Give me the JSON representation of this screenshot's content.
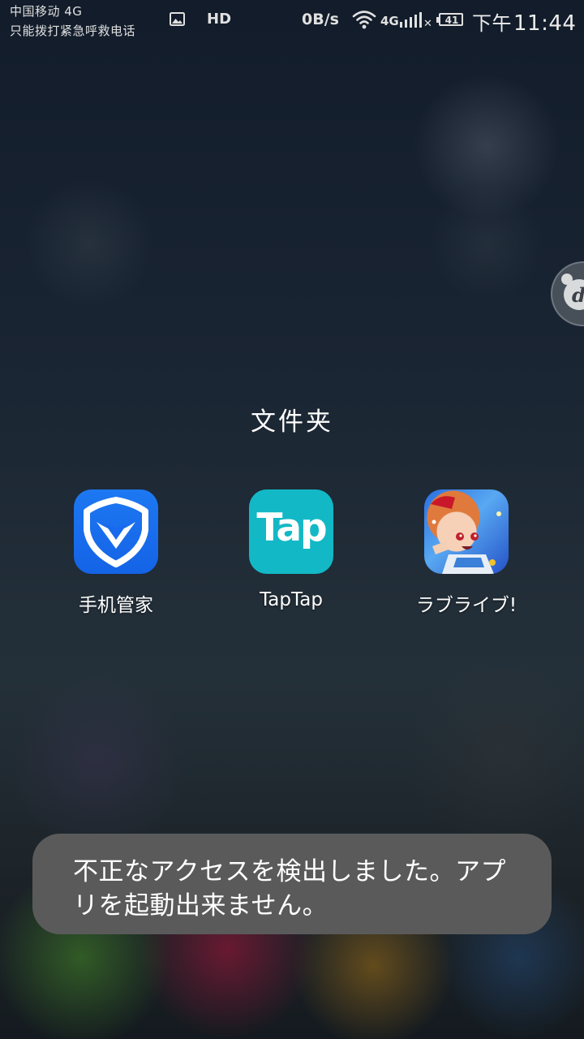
{
  "status_bar": {
    "carrier_line_1": "中国移动 4G",
    "carrier_line_2": "只能拨打紧急呼救电话",
    "hd_label": "HD",
    "net_speed": "0B/s",
    "signal_label": "4G",
    "battery_level": "41",
    "clock_period": "下午",
    "clock_time": "11:44",
    "icons": [
      "gallery-icon",
      "wifi-icon",
      "signal-icon",
      "no-signal-icon",
      "battery-icon"
    ]
  },
  "floating_ball": {
    "letter": "d"
  },
  "folder": {
    "title": "文件夹",
    "apps": [
      {
        "label": "手机管家",
        "icon": "guanjia-shield-icon",
        "color": "#1769ee"
      },
      {
        "label": "TapTap",
        "icon": "taptap-icon",
        "icon_text": "Tap",
        "color": "#13b8c6"
      },
      {
        "label": "ラブライブ!",
        "icon": "lovelive-icon"
      }
    ]
  },
  "toast": {
    "message": "不正なアクセスを検出しました。アプリを起動出来ません。"
  }
}
